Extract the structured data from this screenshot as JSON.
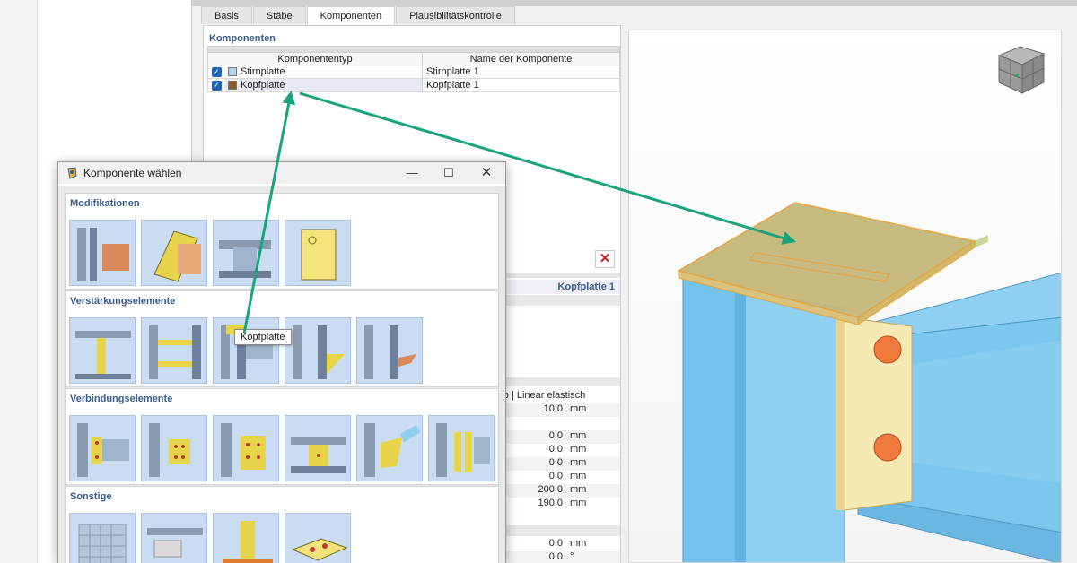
{
  "tabs": [
    "Basis",
    "Stäbe",
    "Komponenten",
    "Plausibilitätskontrolle"
  ],
  "komponenten": {
    "section_title": "Komponenten",
    "columns": [
      "Komponententyp",
      "Name der Komponente"
    ],
    "rows": [
      {
        "type": "Stirnplatte",
        "name": "Stirnplatte 1",
        "color": "#a6d4e6"
      },
      {
        "type": "Kopfplatte",
        "name": "Kopfplatte 1",
        "color": "#8b5a2b"
      }
    ],
    "delete_icon": "delete-x-icon"
  },
  "properties": {
    "header": "Kopfplatte 1",
    "material": "rop | Linear elastisch",
    "rows": [
      {
        "value": "10.0",
        "unit": "mm"
      },
      {
        "value": "0.0",
        "unit": "mm"
      },
      {
        "value": "0.0",
        "unit": "mm"
      },
      {
        "value": "0.0",
        "unit": "mm"
      },
      {
        "value": "0.0",
        "unit": "mm"
      },
      {
        "value": "200.0",
        "unit": "mm"
      },
      {
        "value": "190.0",
        "unit": "mm"
      },
      {
        "value": "0.0",
        "unit": "mm"
      },
      {
        "value": "0.0",
        "unit": "°"
      }
    ]
  },
  "dialog": {
    "title": "Komponente wählen",
    "groups": [
      {
        "title": "Modifikationen",
        "count": 4
      },
      {
        "title": "Verstärkungselemente",
        "count": 5
      },
      {
        "title": "Verbindungselemente",
        "count": 6
      },
      {
        "title": "Sonstige",
        "count": 4
      }
    ],
    "tooltip": "Kopfplatte"
  },
  "colors": {
    "accent_blue": "#3a5b8c",
    "arrow_green": "#1aa37d",
    "steel_blue": "#74c3ec",
    "plate_yellow": "#e6d070"
  }
}
